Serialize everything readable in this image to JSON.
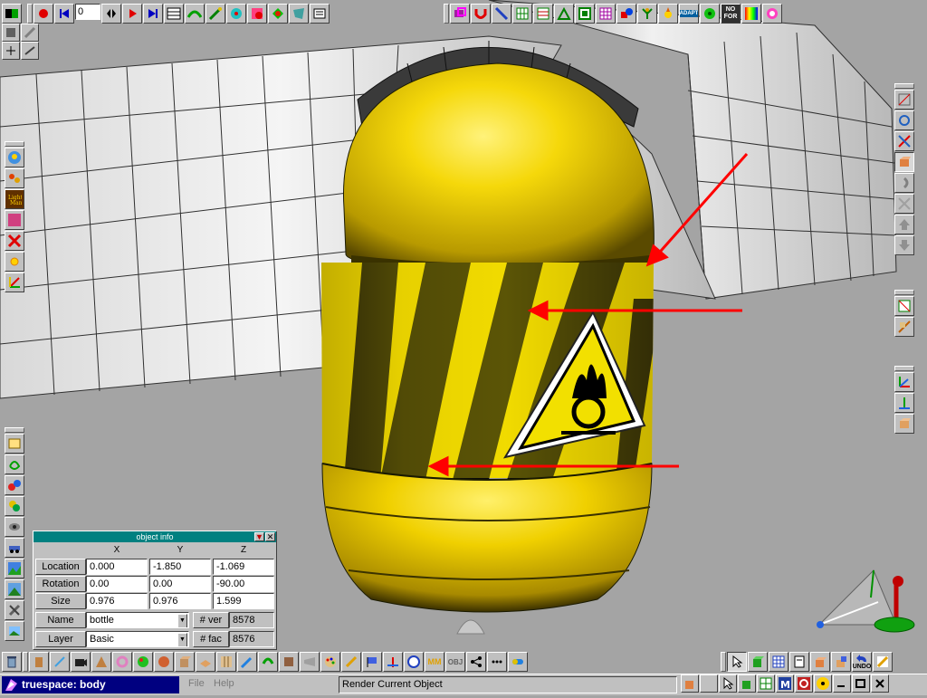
{
  "app": {
    "title": "truespace: body",
    "menu": [
      "File",
      "Help"
    ],
    "status_message": "Render Current Object"
  },
  "top_toolbar": {
    "frame_value": "0",
    "left_tools": [
      "record-icon",
      "rewind-icon",
      "frame-input",
      "key-icon",
      "play-icon",
      "end-icon",
      "keyframe-editor-icon",
      "path-icon",
      "point-edit-icon",
      "view-icon",
      "material-icon",
      "paint-icon",
      "deform-icon",
      "text-tool-icon"
    ],
    "right_tools": [
      "boolean-icon",
      "magnet-icon",
      "sweep-icon",
      "grid-icon",
      "subdivide-icon",
      "lathe-icon",
      "tile-icon",
      "uv-grid-icon",
      "shapes-icon",
      "plant-icon",
      "sun-icon",
      "adapt-icon",
      "cube-icon",
      "norender-icon",
      "color-icon",
      "light-burst-icon"
    ],
    "adapt_label": "ADAPT",
    "nofo_label_1": "NO",
    "nofo_label_2": "FOR"
  },
  "object_info": {
    "title": "object info",
    "columns": [
      "X",
      "Y",
      "Z"
    ],
    "location": {
      "label": "Location",
      "x": "0.000",
      "y": "-1.850",
      "z": "-1.069"
    },
    "rotation": {
      "label": "Rotation",
      "x": "0.00",
      "y": "0.00",
      "z": "-90.00"
    },
    "size": {
      "label": "Size",
      "x": "0.976",
      "y": "0.976",
      "z": "1.599"
    },
    "name": {
      "label": "Name",
      "value": "bottle"
    },
    "layer": {
      "label": "Layer",
      "value": "Basic"
    },
    "vertices": {
      "label": "# ver",
      "value": "8578"
    },
    "faces": {
      "label": "# fac",
      "value": "8576"
    }
  },
  "bottom_right": {
    "undo_label": "UNDO",
    "obj_label": "OBJ",
    "mm_label": "MM"
  },
  "colors": {
    "background": "#a4a4a4",
    "title_bar": "#008080",
    "app_title_bar": "#000080",
    "bottle_yellow": "#f0d000",
    "annotation_arrow": "#ff0000"
  }
}
